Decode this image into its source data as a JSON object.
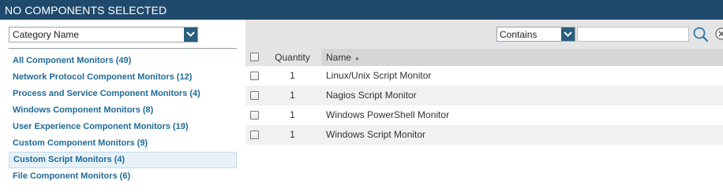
{
  "header": {
    "title": "NO COMPONENTS SELECTED"
  },
  "left": {
    "group_by": {
      "value": "Category Name"
    },
    "categories": [
      "All Component Monitors (49)",
      "Network Protocol Component Monitors (12)",
      "Process and Service Component Monitors (4)",
      "Windows Component Monitors (8)",
      "User Experience Component Monitors (19)",
      "Custom Component Monitors (9)",
      "Custom Script Monitors (4)",
      "File Component Monitors (6)"
    ],
    "selected_index": 6
  },
  "toolbar": {
    "filter_mode": "Contains",
    "search_value": "",
    "search_icon": "search-icon",
    "clear_icon": "clear-icon"
  },
  "table": {
    "columns": {
      "quantity": "Quantity",
      "name": "Name"
    },
    "sort": {
      "column": "Name",
      "direction": "ascending"
    },
    "rows": [
      {
        "quantity": "1",
        "name": "Linux/Unix Script Monitor"
      },
      {
        "quantity": "1",
        "name": "Nagios Script Monitor"
      },
      {
        "quantity": "1",
        "name": "Windows PowerShell Monitor"
      },
      {
        "quantity": "1",
        "name": "Windows Script Monitor"
      }
    ]
  },
  "colors": {
    "header_bg": "#204a6b",
    "link": "#1f6b98",
    "dropdown_arrow_bg": "#2a5f7e",
    "toolbar_bg": "#e4e4e4"
  }
}
